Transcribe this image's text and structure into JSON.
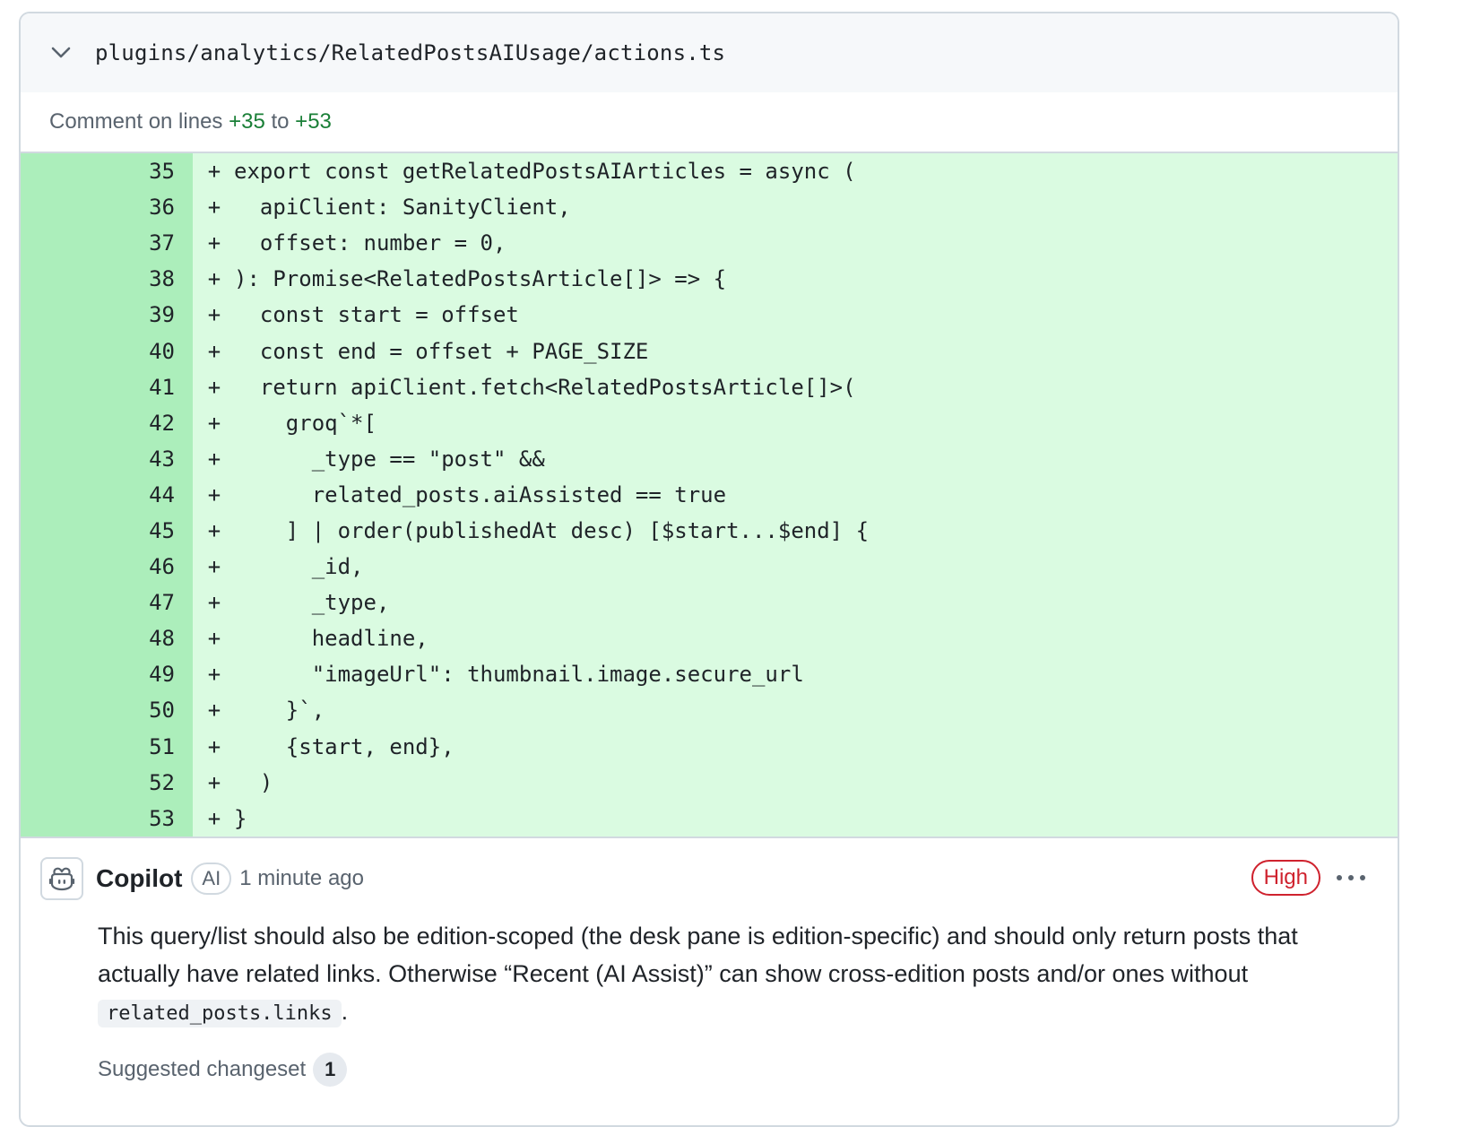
{
  "file": {
    "path": "plugins/analytics/RelatedPostsAIUsage/actions.ts",
    "toggle_icon": "chevron-down-icon"
  },
  "comment_range": {
    "prefix": "Comment on lines",
    "start": "+35",
    "middle": "to",
    "end": "+53"
  },
  "code_lines": [
    {
      "num": "35",
      "marker": "+",
      "text": "export const getRelatedPostsAIArticles = async ("
    },
    {
      "num": "36",
      "marker": "+",
      "text": "  apiClient: SanityClient,"
    },
    {
      "num": "37",
      "marker": "+",
      "text": "  offset: number = 0,"
    },
    {
      "num": "38",
      "marker": "+",
      "text": "): Promise<RelatedPostsArticle[]> => {"
    },
    {
      "num": "39",
      "marker": "+",
      "text": "  const start = offset"
    },
    {
      "num": "40",
      "marker": "+",
      "text": "  const end = offset + PAGE_SIZE"
    },
    {
      "num": "41",
      "marker": "+",
      "text": "  return apiClient.fetch<RelatedPostsArticle[]>("
    },
    {
      "num": "42",
      "marker": "+",
      "text": "    groq`*["
    },
    {
      "num": "43",
      "marker": "+",
      "text": "      _type == \"post\" &&"
    },
    {
      "num": "44",
      "marker": "+",
      "text": "      related_posts.aiAssisted == true"
    },
    {
      "num": "45",
      "marker": "+",
      "text": "    ] | order(publishedAt desc) [$start...$end] {"
    },
    {
      "num": "46",
      "marker": "+",
      "text": "      _id,"
    },
    {
      "num": "47",
      "marker": "+",
      "text": "      _type,"
    },
    {
      "num": "48",
      "marker": "+",
      "text": "      headline,"
    },
    {
      "num": "49",
      "marker": "+",
      "text": "      \"imageUrl\": thumbnail.image.secure_url"
    },
    {
      "num": "50",
      "marker": "+",
      "text": "    }`,"
    },
    {
      "num": "51",
      "marker": "+",
      "text": "    {start, end},"
    },
    {
      "num": "52",
      "marker": "+",
      "text": "  )"
    },
    {
      "num": "53",
      "marker": "+",
      "text": "}"
    }
  ],
  "comment": {
    "avatar_icon": "copilot-icon",
    "author": "Copilot",
    "ai_badge": "AI",
    "timestamp": "1 minute ago",
    "severity": "High",
    "severity_color": "#cf222e",
    "menu_icon": "kebab-horizontal-icon",
    "body_before": "This query/list should also be edition-scoped (the desk pane is edition-specific) and should only return posts that actually have related links. Otherwise “Recent (AI Assist)” can show cross-edition posts and/or ones without ",
    "body_code": "related_posts.links",
    "body_after": ".",
    "changeset_label": "Suggested changeset",
    "changeset_count": "1"
  },
  "colors": {
    "addition_bg": "#dafbe1",
    "addition_gutter": "#aceebb",
    "line_ref_green": "#1a7f37"
  }
}
